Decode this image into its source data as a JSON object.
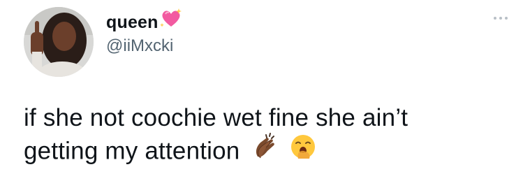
{
  "author": {
    "display_name": "queen",
    "handle": "@iiMxcki",
    "name_emoji": "sparkling-heart-icon"
  },
  "menu": {
    "icon": "more-horizontal-icon"
  },
  "tweet": {
    "line1": "if she not coochie wet fine she ain’t",
    "line2": "getting my attention",
    "emojis": [
      "clapping-hands-icon",
      "yawning-face-icon"
    ]
  },
  "colors": {
    "text": "#0f1419",
    "secondary": "#536471",
    "heart": "#f25aa0",
    "yawn": "#ffc83d"
  }
}
